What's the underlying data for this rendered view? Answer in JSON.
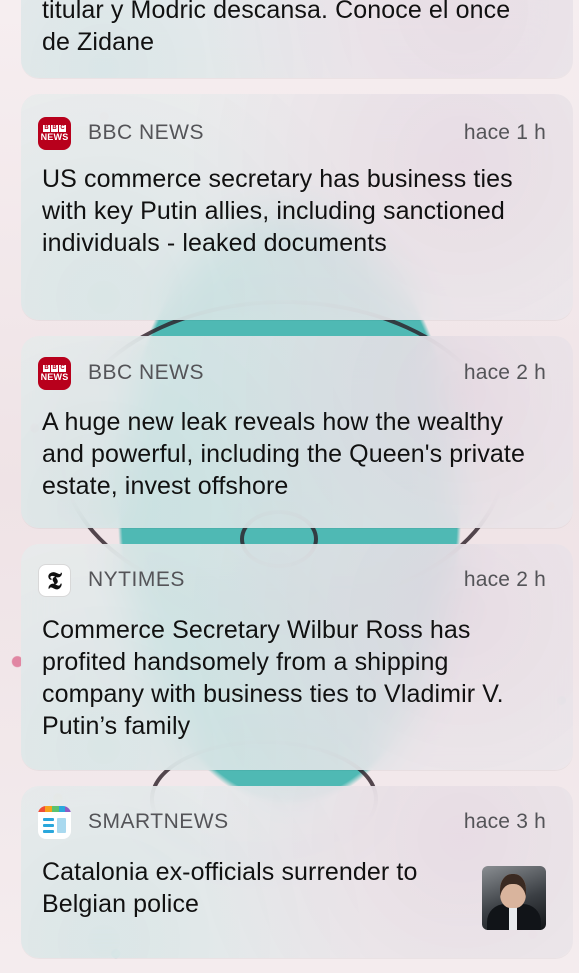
{
  "notifications": [
    {
      "app": "",
      "time": "",
      "body": "titular y Modric descansa. Conoce el once de Zidane"
    },
    {
      "app": "BBC NEWS",
      "time": "hace 1 h",
      "body": "US commerce secretary has business ties with key Putin allies, including sanctioned individuals - leaked documents",
      "icon": "bbc-news-icon"
    },
    {
      "app": "BBC NEWS",
      "time": "hace 2 h",
      "body": "A huge new leak reveals how the wealthy and powerful, including the Queen's private estate, invest offshore",
      "icon": "bbc-news-icon"
    },
    {
      "app": "NYTIMES",
      "time": "hace 2 h",
      "body": "Commerce Secretary Wilbur Ross has profited handsomely from a shipping company with business ties to Vladimir V. Putin’s family",
      "icon": "nytimes-icon"
    },
    {
      "app": "SMARTNEWS",
      "time": "hace 3 h",
      "body": "Catalonia ex-officials surrender to Belgian police",
      "icon": "smartnews-icon"
    }
  ],
  "icons": {
    "bbc_letters": [
      "B",
      "B",
      "C"
    ],
    "bbc_label": "NEWS",
    "nyt_glyph": "𝕿"
  },
  "colors": {
    "bbc_red": "#b8001c",
    "card_background": "#ececee",
    "secondary_text": "#545458",
    "body_text": "#111111"
  }
}
